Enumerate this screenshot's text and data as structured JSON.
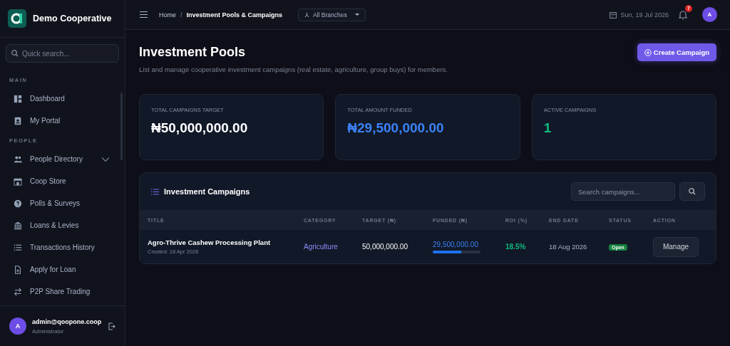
{
  "sidebar": {
    "brand": "Demo Cooperative",
    "search": {
      "placeholder": "Quick search..."
    },
    "sections": [
      {
        "label": "MAIN",
        "items": [
          {
            "label": "Dashboard"
          },
          {
            "label": "My Portal"
          }
        ]
      },
      {
        "label": "PEOPLE",
        "items": [
          {
            "label": "People Directory",
            "expanded": false
          },
          {
            "label": "Coop Store"
          },
          {
            "label": "Polls & Surveys"
          },
          {
            "label": "Loans & Levies"
          },
          {
            "label": "Transactions History"
          },
          {
            "label": "Apply for Loan"
          },
          {
            "label": "P2P Share Trading"
          }
        ]
      }
    ],
    "user": {
      "initial": "A",
      "email": "admin@qoopone.coop",
      "role": "Administrator"
    }
  },
  "topbar": {
    "breadcrumb": [
      "Home",
      "Investment Pools & Campaigns"
    ],
    "breadcrumb_separator": "/",
    "branch": "All Branches",
    "date": "Sun, 19 Jul 2026",
    "notifications": "7",
    "avatar": "A"
  },
  "page": {
    "title": "Investment Pools",
    "subtitle": "List and manage cooperative investment campaigns (real estate, agriculture, group buys) for members.",
    "create_button": "Create Campaign"
  },
  "stats": [
    {
      "label": "TOTAL CAMPAIGNS TARGET",
      "value": "₦50,000,000.00",
      "color": "#ffffff"
    },
    {
      "label": "TOTAL AMOUNT FUNDED",
      "value": "₦29,500,000.00",
      "color": "#3b82f6"
    },
    {
      "label": "ACTIVE CAMPAIGNS",
      "value": "1",
      "color": "#10b981"
    }
  ],
  "campaigns": {
    "title": "Investment Campaigns",
    "search": {
      "placeholder": "Search campaigns..."
    },
    "columns": [
      "TITLE",
      "CATEGORY",
      "TARGET (₦)",
      "FUNDED (₦)",
      "ROI (%)",
      "END DATE",
      "STATUS",
      "ACTION"
    ],
    "rows": [
      {
        "title": "Agro-Thrive Cashew Processing Plant",
        "created": "Created: 18 Apr 2026",
        "category": "Agriculture",
        "target": "50,000,000.00",
        "funded": "29,500,000.00",
        "level": 0.59,
        "roi": "18.5%",
        "end_date": "18 Aug 2026",
        "status": "Open",
        "action": "Manage"
      }
    ]
  }
}
